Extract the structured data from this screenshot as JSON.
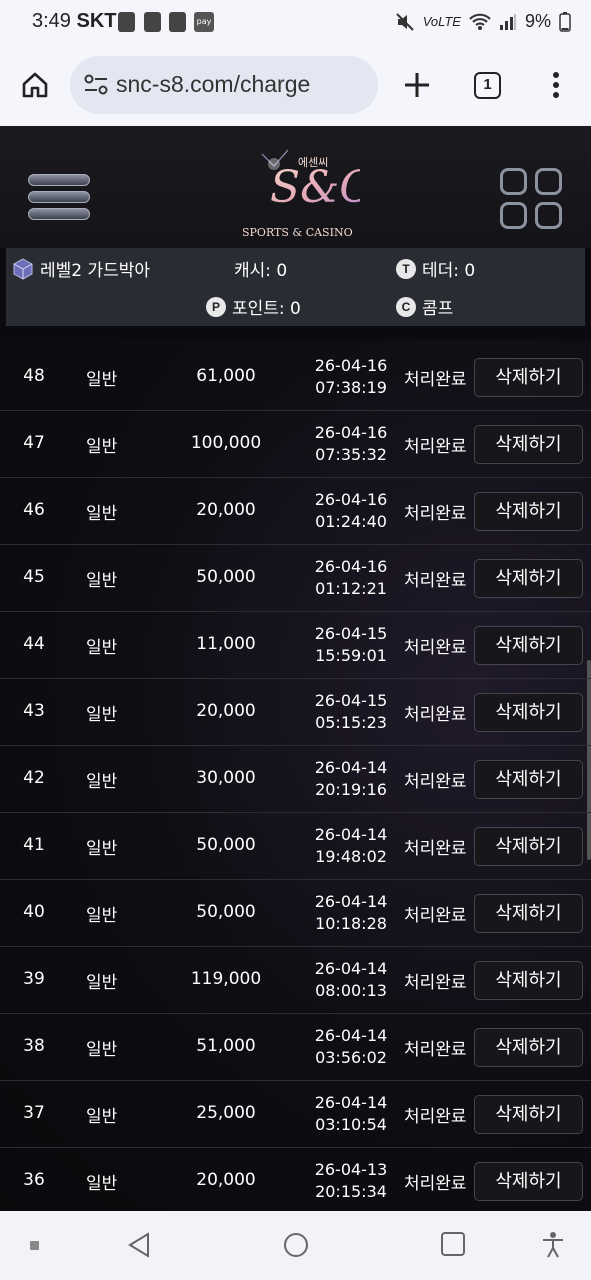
{
  "status_bar": {
    "time": "3:49",
    "carrier": "SKT",
    "pay_label": "pay",
    "network": "VoLTE",
    "battery": "9%"
  },
  "browser": {
    "url": "snc-s8.com/charge",
    "tab_count": "1"
  },
  "header": {
    "logo_korean": "에센씨",
    "logo_mark": "S&C",
    "logo_sub": "SPORTS & CASINO"
  },
  "user_info": {
    "level": "레벨2 가드박아",
    "cash": "캐시: 0",
    "tether": "테더: 0",
    "points": "포인트: 0",
    "comp": "콤프",
    "tether_icon": "T",
    "points_icon": "P",
    "comp_icon": "C"
  },
  "rows": [
    {
      "num": "48",
      "type": "일반",
      "amount": "61,000",
      "date": "26-04-16",
      "time": "07:38:19",
      "status": "처리완료",
      "delete": "삭제하기"
    },
    {
      "num": "47",
      "type": "일반",
      "amount": "100,000",
      "date": "26-04-16",
      "time": "07:35:32",
      "status": "처리완료",
      "delete": "삭제하기"
    },
    {
      "num": "46",
      "type": "일반",
      "amount": "20,000",
      "date": "26-04-16",
      "time": "01:24:40",
      "status": "처리완료",
      "delete": "삭제하기"
    },
    {
      "num": "45",
      "type": "일반",
      "amount": "50,000",
      "date": "26-04-16",
      "time": "01:12:21",
      "status": "처리완료",
      "delete": "삭제하기"
    },
    {
      "num": "44",
      "type": "일반",
      "amount": "11,000",
      "date": "26-04-15",
      "time": "15:59:01",
      "status": "처리완료",
      "delete": "삭제하기"
    },
    {
      "num": "43",
      "type": "일반",
      "amount": "20,000",
      "date": "26-04-15",
      "time": "05:15:23",
      "status": "처리완료",
      "delete": "삭제하기"
    },
    {
      "num": "42",
      "type": "일반",
      "amount": "30,000",
      "date": "26-04-14",
      "time": "20:19:16",
      "status": "처리완료",
      "delete": "삭제하기"
    },
    {
      "num": "41",
      "type": "일반",
      "amount": "50,000",
      "date": "26-04-14",
      "time": "19:48:02",
      "status": "처리완료",
      "delete": "삭제하기"
    },
    {
      "num": "40",
      "type": "일반",
      "amount": "50,000",
      "date": "26-04-14",
      "time": "10:18:28",
      "status": "처리완료",
      "delete": "삭제하기"
    },
    {
      "num": "39",
      "type": "일반",
      "amount": "119,000",
      "date": "26-04-14",
      "time": "08:00:13",
      "status": "처리완료",
      "delete": "삭제하기"
    },
    {
      "num": "38",
      "type": "일반",
      "amount": "51,000",
      "date": "26-04-14",
      "time": "03:56:02",
      "status": "처리완료",
      "delete": "삭제하기"
    },
    {
      "num": "37",
      "type": "일반",
      "amount": "25,000",
      "date": "26-04-14",
      "time": "03:10:54",
      "status": "처리완료",
      "delete": "삭제하기"
    },
    {
      "num": "36",
      "type": "일반",
      "amount": "20,000",
      "date": "26-04-13",
      "time": "20:15:34",
      "status": "처리완료",
      "delete": "삭제하기"
    }
  ]
}
